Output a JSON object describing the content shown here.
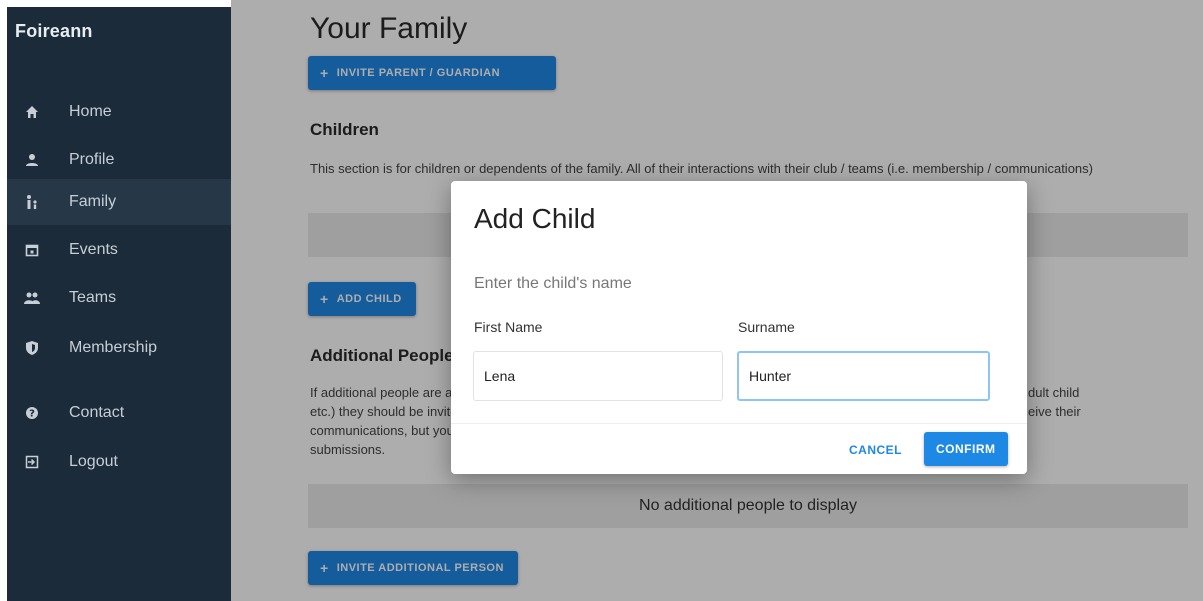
{
  "app": {
    "brand": "Foireann"
  },
  "sidebar": {
    "items": [
      {
        "label": "Home",
        "icon": "home-icon"
      },
      {
        "label": "Profile",
        "icon": "person-icon"
      },
      {
        "label": "Family",
        "icon": "family-icon"
      },
      {
        "label": "Events",
        "icon": "calendar-icon"
      },
      {
        "label": "Teams",
        "icon": "group-icon"
      },
      {
        "label": "Membership",
        "icon": "shield-icon"
      },
      {
        "label": "Contact",
        "icon": "help-icon"
      },
      {
        "label": "Logout",
        "icon": "logout-icon"
      }
    ],
    "active": "Family"
  },
  "main": {
    "title": "Your Family",
    "invite_guardian_label": "INVITE PARENT / GUARDIAN",
    "children": {
      "title": "Children",
      "description": "This section is for children or dependents of the family. All of their interactions with their club / teams (i.e. membership / communications)",
      "add_label": "ADD CHILD"
    },
    "additional": {
      "title": "Additional People",
      "desc_line1": "If additional people are added to your family (e.g. adult child",
      "desc_line2": "etc.) they should be invited so they can receive their",
      "desc_line3": "communications, but you will manage",
      "desc_line4": "submissions.",
      "right_1": "dult child",
      "right_2": "eive their",
      "right_3": "",
      "empty_text": "No additional people to display",
      "invite_label": "INVITE ADDITIONAL PERSON"
    }
  },
  "dialog": {
    "title": "Add Child",
    "subtitle": "Enter the child's name",
    "first_name_label": "First Name",
    "first_name_value": "Lena",
    "surname_label": "Surname",
    "surname_value": "Hunter",
    "cancel_label": "CANCEL",
    "confirm_label": "CONFIRM"
  },
  "colors": {
    "sidebar_bg": "#1c2b3a",
    "accent": "#1e88e5",
    "overlay": "rgba(0,0,0,0.32)"
  }
}
